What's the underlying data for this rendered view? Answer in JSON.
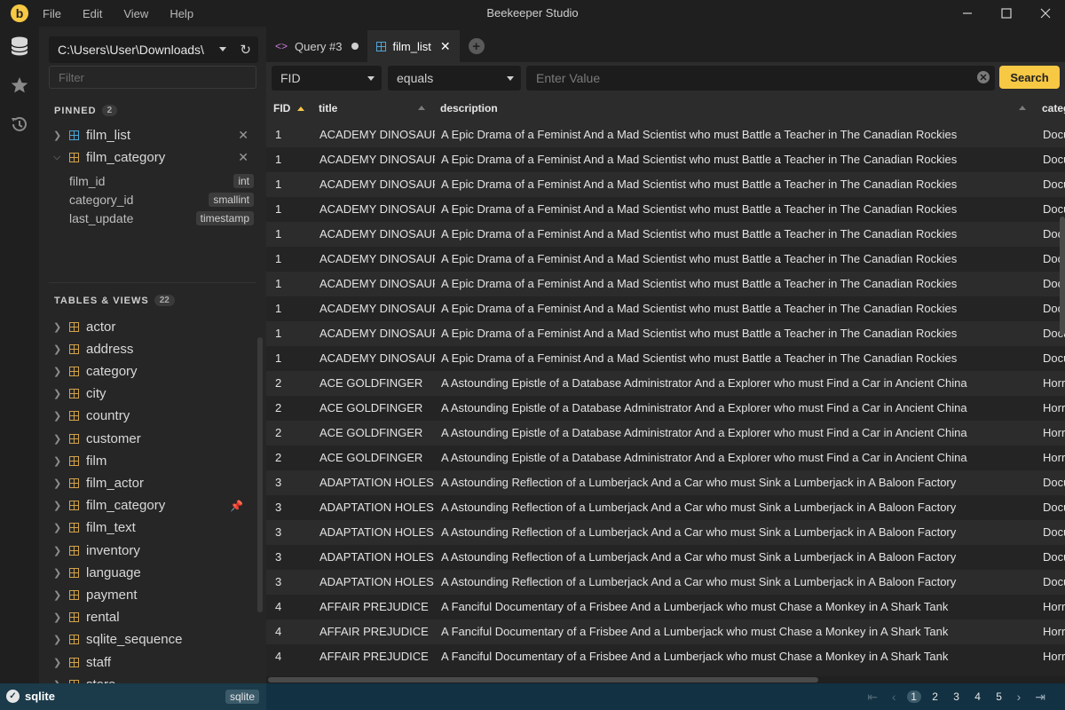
{
  "window": {
    "title": "Beekeeper Studio",
    "logo_letter": "b",
    "menus": [
      "File",
      "Edit",
      "View",
      "Help"
    ]
  },
  "sidebar": {
    "connection": "C:\\Users\\User\\Downloads\\",
    "filter_placeholder": "Filter",
    "pinned": {
      "title": "PINNED",
      "count": "2",
      "items": [
        {
          "name": "film_list",
          "expanded": false
        },
        {
          "name": "film_category",
          "expanded": true,
          "columns": [
            {
              "name": "film_id",
              "type": "int"
            },
            {
              "name": "category_id",
              "type": "smallint"
            },
            {
              "name": "last_update",
              "type": "timestamp"
            }
          ]
        }
      ]
    },
    "tables": {
      "title": "TABLES & VIEWS",
      "count": "22",
      "items": [
        "actor",
        "address",
        "category",
        "city",
        "country",
        "customer",
        "film",
        "film_actor",
        "film_category",
        "film_text",
        "inventory",
        "language",
        "payment",
        "rental",
        "sqlite_sequence",
        "staff",
        "store"
      ]
    }
  },
  "tabs": [
    {
      "label": "Query #3",
      "icon": "code-icon",
      "unsaved": true
    },
    {
      "label": "film_list",
      "icon": "table-icon",
      "active": true
    }
  ],
  "filter": {
    "field": "FID",
    "operator": "equals",
    "value_placeholder": "Enter Value",
    "search_label": "Search"
  },
  "grid": {
    "columns": [
      "FID",
      "title",
      "description",
      "categ"
    ],
    "rows": [
      [
        "1",
        "ACADEMY DINOSAUR",
        "A Epic Drama of a Feminist And a Mad Scientist who must Battle a Teacher in The Canadian Rockies",
        "Documentary"
      ],
      [
        "1",
        "ACADEMY DINOSAUR",
        "A Epic Drama of a Feminist And a Mad Scientist who must Battle a Teacher in The Canadian Rockies",
        "Documentary"
      ],
      [
        "1",
        "ACADEMY DINOSAUR",
        "A Epic Drama of a Feminist And a Mad Scientist who must Battle a Teacher in The Canadian Rockies",
        "Documentary"
      ],
      [
        "1",
        "ACADEMY DINOSAUR",
        "A Epic Drama of a Feminist And a Mad Scientist who must Battle a Teacher in The Canadian Rockies",
        "Documentary"
      ],
      [
        "1",
        "ACADEMY DINOSAUR",
        "A Epic Drama of a Feminist And a Mad Scientist who must Battle a Teacher in The Canadian Rockies",
        "Documentary"
      ],
      [
        "1",
        "ACADEMY DINOSAUR",
        "A Epic Drama of a Feminist And a Mad Scientist who must Battle a Teacher in The Canadian Rockies",
        "Documentary"
      ],
      [
        "1",
        "ACADEMY DINOSAUR",
        "A Epic Drama of a Feminist And a Mad Scientist who must Battle a Teacher in The Canadian Rockies",
        "Documentary"
      ],
      [
        "1",
        "ACADEMY DINOSAUR",
        "A Epic Drama of a Feminist And a Mad Scientist who must Battle a Teacher in The Canadian Rockies",
        "Documentary"
      ],
      [
        "1",
        "ACADEMY DINOSAUR",
        "A Epic Drama of a Feminist And a Mad Scientist who must Battle a Teacher in The Canadian Rockies",
        "Documentary"
      ],
      [
        "1",
        "ACADEMY DINOSAUR",
        "A Epic Drama of a Feminist And a Mad Scientist who must Battle a Teacher in The Canadian Rockies",
        "Documentary"
      ],
      [
        "2",
        "ACE GOLDFINGER",
        "A Astounding Epistle of a Database Administrator And a Explorer who must Find a Car in Ancient China",
        "Horror"
      ],
      [
        "2",
        "ACE GOLDFINGER",
        "A Astounding Epistle of a Database Administrator And a Explorer who must Find a Car in Ancient China",
        "Horror"
      ],
      [
        "2",
        "ACE GOLDFINGER",
        "A Astounding Epistle of a Database Administrator And a Explorer who must Find a Car in Ancient China",
        "Horror"
      ],
      [
        "2",
        "ACE GOLDFINGER",
        "A Astounding Epistle of a Database Administrator And a Explorer who must Find a Car in Ancient China",
        "Horror"
      ],
      [
        "3",
        "ADAPTATION HOLES",
        "A Astounding Reflection of a Lumberjack And a Car who must Sink a Lumberjack in A Baloon Factory",
        "Documentary"
      ],
      [
        "3",
        "ADAPTATION HOLES",
        "A Astounding Reflection of a Lumberjack And a Car who must Sink a Lumberjack in A Baloon Factory",
        "Documentary"
      ],
      [
        "3",
        "ADAPTATION HOLES",
        "A Astounding Reflection of a Lumberjack And a Car who must Sink a Lumberjack in A Baloon Factory",
        "Documentary"
      ],
      [
        "3",
        "ADAPTATION HOLES",
        "A Astounding Reflection of a Lumberjack And a Car who must Sink a Lumberjack in A Baloon Factory",
        "Documentary"
      ],
      [
        "3",
        "ADAPTATION HOLES",
        "A Astounding Reflection of a Lumberjack And a Car who must Sink a Lumberjack in A Baloon Factory",
        "Documentary"
      ],
      [
        "4",
        "AFFAIR PREJUDICE",
        "A Fanciful Documentary of a Frisbee And a Lumberjack who must Chase a Monkey in A Shark Tank",
        "Horror"
      ],
      [
        "4",
        "AFFAIR PREJUDICE",
        "A Fanciful Documentary of a Frisbee And a Lumberjack who must Chase a Monkey in A Shark Tank",
        "Horror"
      ],
      [
        "4",
        "AFFAIR PREJUDICE",
        "A Fanciful Documentary of a Frisbee And a Lumberjack who must Chase a Monkey in A Shark Tank",
        "Horror"
      ]
    ]
  },
  "status": {
    "connection_name": "sqlite",
    "connection_type": "sqlite",
    "pages": [
      "1",
      "2",
      "3",
      "4",
      "5"
    ],
    "current_page": "1"
  },
  "colors": {
    "accent": "#f7c844",
    "status_bar": "#123142"
  }
}
